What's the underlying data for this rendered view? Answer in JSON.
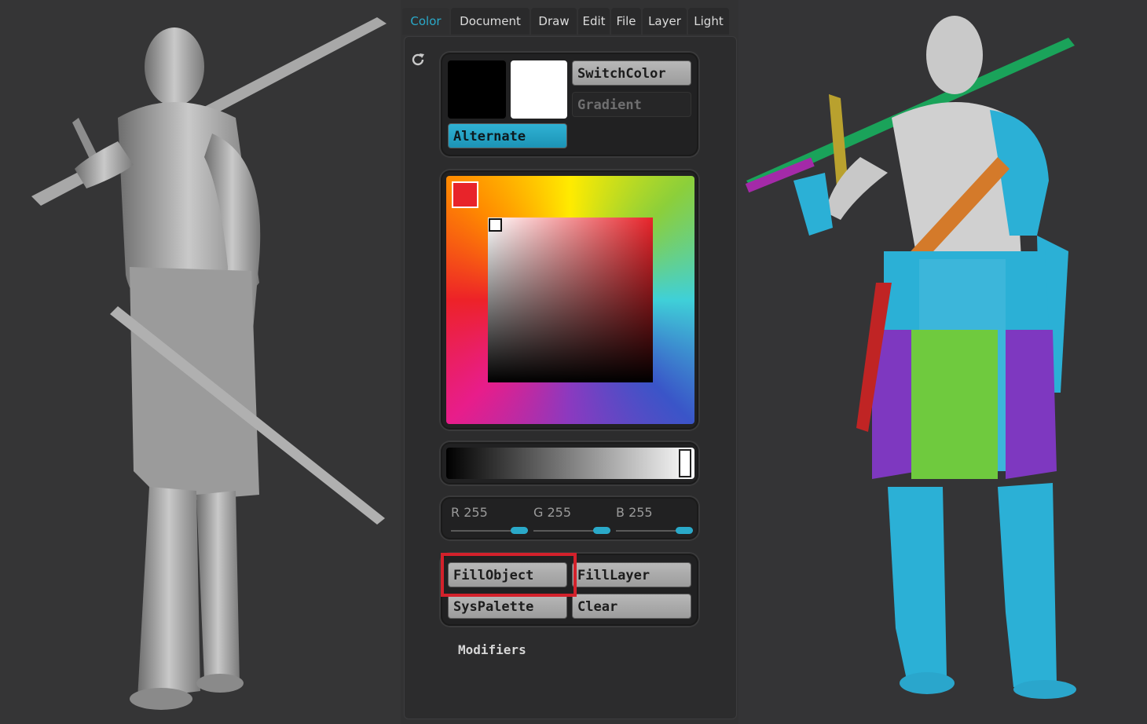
{
  "menu": {
    "tabs": [
      {
        "label": "Color",
        "active": true
      },
      {
        "label": "Document"
      },
      {
        "label": "Draw"
      },
      {
        "label": "Edit"
      },
      {
        "label": "File"
      },
      {
        "label": "Layer"
      },
      {
        "label": "Light"
      }
    ]
  },
  "color_palette": {
    "main_color": "#000000",
    "secondary_color": "#ffffff",
    "switch_color_label": "SwitchColor",
    "gradient_label": "Gradient",
    "alternate_label": "Alternate",
    "picked_color": "#e8242a",
    "brightness_value": 1.0,
    "r_label": "R 255",
    "g_label": "G 255",
    "b_label": "B 255",
    "r_value": 255,
    "g_value": 255,
    "b_value": 255,
    "fill_object_label": "FillObject",
    "fill_layer_label": "FillLayer",
    "sys_palette_label": "SysPalette",
    "clear_label": "Clear",
    "modifiers_label": "Modifiers",
    "accent_color": "#2aa9c9",
    "highlight_color": "#d3212b"
  },
  "viewports": {
    "left_model": "grey unpainted armored warrior sculpt holding sword",
    "right_model": "polypainted warrior sculpt with colored armor"
  }
}
